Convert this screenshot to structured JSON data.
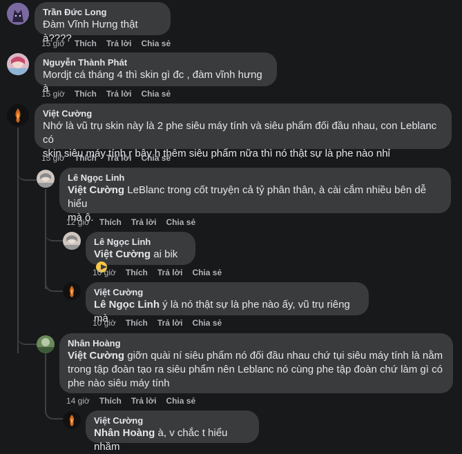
{
  "comments": [
    {
      "name": "Trần Đức Long",
      "mention": "",
      "text": "Đàm Vĩnh Hưng thật à????",
      "time": "15 giờ",
      "like": "Thích",
      "reply": "Trả lời",
      "share": "Chia sẻ"
    },
    {
      "name": "Nguyễn Thành Phát",
      "mention": "",
      "text": "Mordjt cá tháng 4 thì skin gì đc , đàm vĩnh hưng à",
      "time": "15 giờ",
      "like": "Thích",
      "reply": "Trả lời",
      "share": "Chia sẻ"
    },
    {
      "name": "Việt Cường",
      "mention": "",
      "text_line1": "Nhớ là vũ trụ skin này là 2 phe siêu máy tính và siêu phẩm đối đầu nhau, con Leblanc có",
      "text_line2": "skin siêu máy tính r bây h thêm siêu phẩm nữa thì nó thật sự là phe nào nhỉ",
      "time": "15 giờ",
      "like": "Thích",
      "reply": "Trả lời",
      "share": "Chia sẻ"
    },
    {
      "name": "Lê Ngọc Linh",
      "mention": "Việt Cường",
      "text_line1": " LeBlanc trong cốt truyện cả tỷ phân thân, à cài cắm nhiều bên dễ hiểu",
      "text_line2": "mà ô.",
      "time": "12 giờ",
      "like": "Thích",
      "reply": "Trả lời",
      "share": "Chia sẻ"
    },
    {
      "name": "Lê Ngọc Linh",
      "mention": "Việt Cường",
      "text": " ai bik",
      "time": "10 giờ",
      "like": "Thích",
      "reply": "Trả lời",
      "share": "Chia sẻ"
    },
    {
      "name": "Việt Cường",
      "mention": "Lê Ngọc Linh",
      "text": " ý là nó thật sự là phe nào ấy, vũ trụ riêng mà",
      "time": "10 giờ",
      "like": "Thích",
      "reply": "Trả lời",
      "share": "Chia sẻ"
    },
    {
      "name": "Nhân Hoàng",
      "mention": "Việt Cường",
      "text_line1": " giỡn quài ní siêu phẩm nó đối đầu nhau chứ tụi siêu máy tính là nằm",
      "text_line2": "trong tập đoàn tạo ra siêu phẩm nên Leblanc nó cùng phe tập đoàn chứ làm gì có",
      "text_line3": "phe nào siêu máy tính",
      "time": "14 giờ",
      "like": "Thích",
      "reply": "Trả lời",
      "share": "Chia sẻ"
    },
    {
      "name": "Việt Cường",
      "mention": "Nhân Hoàng",
      "text": " à, v chắc t hiểu nhầm",
      "time": "",
      "like": "",
      "reply": "",
      "share": ""
    }
  ]
}
